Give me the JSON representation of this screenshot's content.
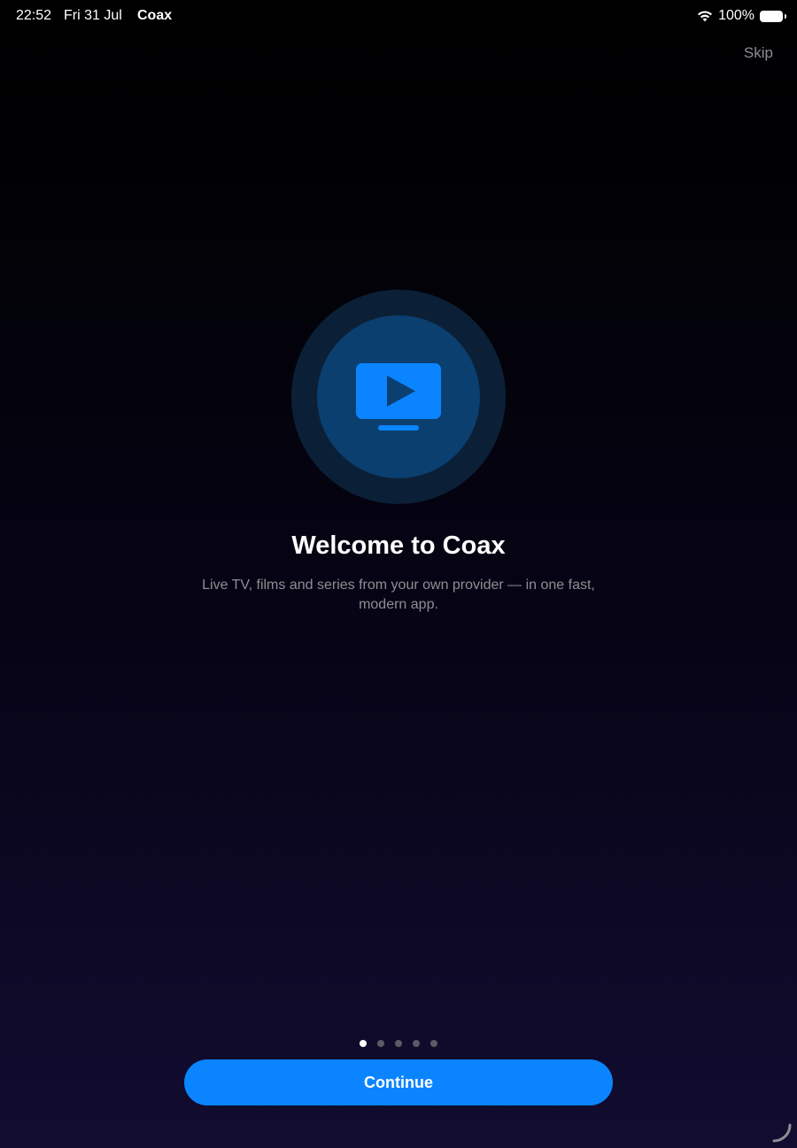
{
  "status_bar": {
    "time": "22:52",
    "date": "Fri 31 Jul",
    "app_name": "Coax",
    "battery": "100%",
    "icons": [
      "wifi-icon",
      "battery-icon"
    ]
  },
  "header": {
    "skip_label": "Skip"
  },
  "hero": {
    "icon": "tv-play-icon",
    "title": "Welcome to Coax",
    "subtitle": "Live TV, films and series from your own provider — in one fast, modern app."
  },
  "pagination": {
    "total": 5,
    "current": 1
  },
  "footer": {
    "continue_label": "Continue"
  },
  "colors": {
    "accent": "#0a84ff",
    "muted_text": "#8e8e93",
    "background_top": "#000000",
    "background_bottom": "#120c30"
  }
}
